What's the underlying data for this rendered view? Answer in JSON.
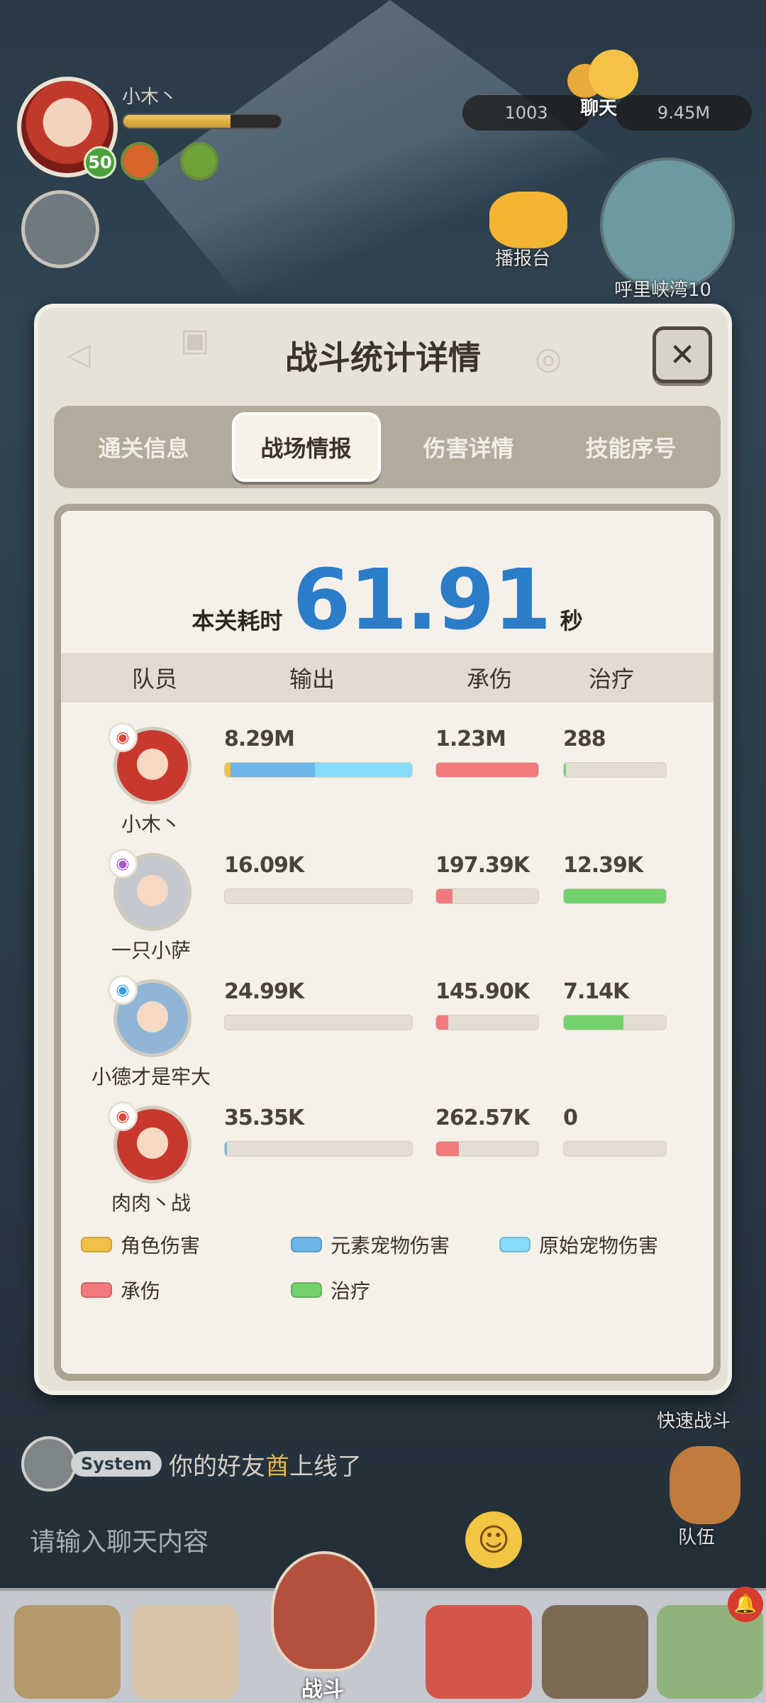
{
  "hud": {
    "player_name": "小木丶",
    "level": "50",
    "xp_fraction": 0.68,
    "resource_1": "1003",
    "resource_2": "9.45M",
    "chat_label": "聊天",
    "broadcast_label": "播报台",
    "map_label": "呼里峡湾10"
  },
  "modal": {
    "title": "战斗统计详情",
    "close_symbol": "✕",
    "tabs": [
      "通关信息",
      "战场情报",
      "伤害详情",
      "技能序号"
    ],
    "active_tab": 1,
    "time_label": "本关耗时",
    "time_value": "61.91",
    "time_unit": "秒",
    "columns": [
      "队员",
      "输出",
      "承伤",
      "治疗"
    ],
    "players": [
      {
        "name": "小木丶",
        "element_icon": "fire-element-icon",
        "element_color": "#e2453a",
        "avatar_color": "#c9382e",
        "output": "8.29M",
        "output_parts": [
          0.03,
          0.45,
          0.52
        ],
        "taken": "1.23M",
        "taken_fraction": 1.0,
        "heal": "288",
        "heal_fraction": 0.02
      },
      {
        "name": "一只小萨",
        "element_icon": "poison-element-icon",
        "element_color": "#a45cc4",
        "avatar_color": "#c4c9cf",
        "output": "16.09K",
        "output_parts": [
          0,
          0,
          0
        ],
        "taken": "197.39K",
        "taken_fraction": 0.16,
        "heal": "12.39K",
        "heal_fraction": 1.0
      },
      {
        "name": "小德才是牢大",
        "element_icon": "water-element-icon",
        "element_color": "#3aa0e0",
        "avatar_color": "#8fb6d6",
        "output": "24.99K",
        "output_parts": [
          0,
          0,
          0
        ],
        "taken": "145.90K",
        "taken_fraction": 0.12,
        "heal": "7.14K",
        "heal_fraction": 0.58
      },
      {
        "name": "肉肉丶战",
        "element_icon": "fire-element-icon",
        "element_color": "#e2453a",
        "avatar_color": "#c9382e",
        "output": "35.35K",
        "output_parts": [
          0,
          0.01,
          0
        ],
        "taken": "262.57K",
        "taken_fraction": 0.22,
        "heal": "0",
        "heal_fraction": 0
      }
    ],
    "legend": [
      {
        "label": "角色伤害",
        "color": "#f2c046"
      },
      {
        "label": "元素宠物伤害",
        "color": "#6cb6ea"
      },
      {
        "label": "原始宠物伤害",
        "color": "#86dcfa"
      },
      {
        "label": "承伤",
        "color": "#f07a7c"
      },
      {
        "label": "治疗",
        "color": "#74d26d"
      }
    ]
  },
  "bottom": {
    "quick_fight": "快速战斗",
    "team_label": "队伍",
    "system_tag": "System",
    "system_msg_prefix": "你的好友",
    "system_msg_name": "酋",
    "system_msg_suffix": "上线了",
    "chat_placeholder": "请输入聊天内容",
    "nav_center_label": "战斗",
    "notify_symbol": "🔔"
  }
}
